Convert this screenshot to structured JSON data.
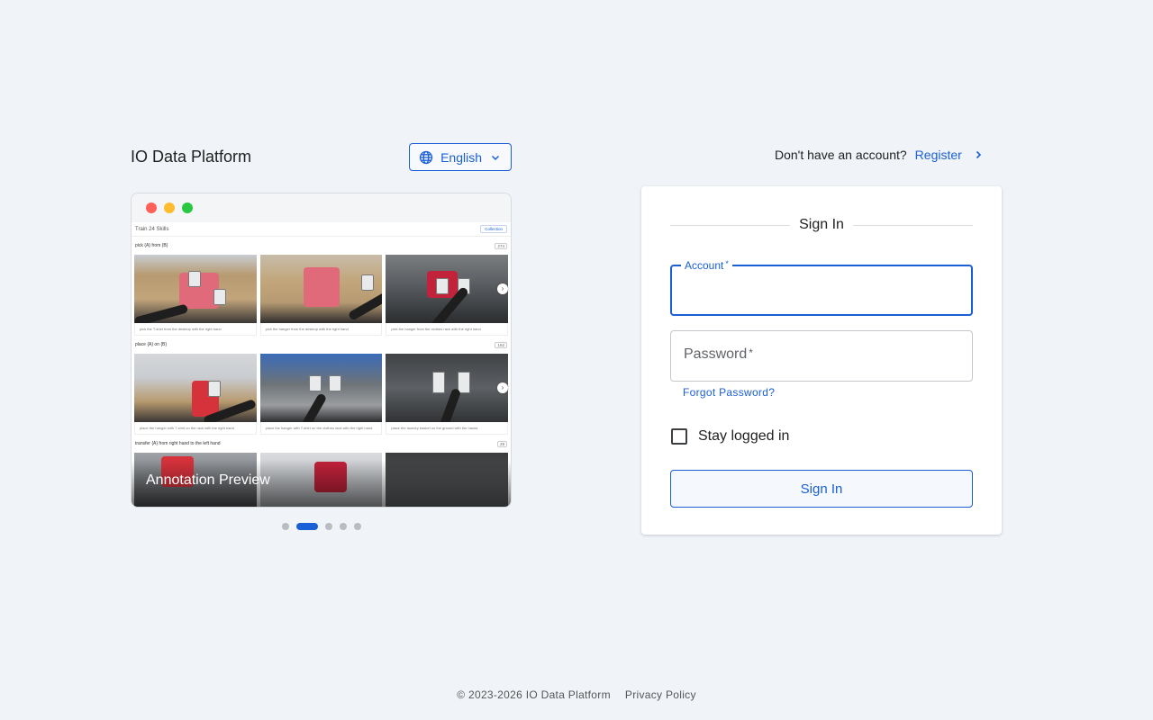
{
  "brand": {
    "name": "IO Data Platform"
  },
  "language": {
    "label": "English",
    "icon": "globe-icon",
    "chevron": "chevron-down-icon"
  },
  "preview": {
    "header_title": "Train 24 Skills",
    "collection_chip": "Collection",
    "sections": [
      {
        "title": "pick {A} from {B}",
        "count": "274",
        "captions": [
          "pick the T-shirt from the desktop with the right hand",
          "pick the hanger from the desktop with the right hand",
          "pick the hanger from the clothes rack with the right hand"
        ]
      },
      {
        "title": "place {A} on {B}",
        "count": "162",
        "captions": [
          "place the hanger with T-shirt on the rack with the right hand",
          "place the hanger with T-shirt on the clothes rack with the right hand",
          "place the laundry basket on the ground with the hands"
        ]
      },
      {
        "title": "transfer {A} from right hand to the left hand",
        "count": "29"
      }
    ],
    "slide_label": "Annotation Preview",
    "pager": {
      "total": 5,
      "active_index": 1
    }
  },
  "register": {
    "question": "Don't have an account?",
    "link": "Register"
  },
  "signin": {
    "title": "Sign In",
    "account_label": "Account",
    "account_value": "",
    "password_label": "Password",
    "password_value": "",
    "required_mark": "*",
    "forgot": "Forgot Password?",
    "stay_logged_in": "Stay logged in",
    "submit": "Sign In"
  },
  "footer": {
    "copyright": "© 2023-2026 IO Data Platform",
    "privacy": "Privacy Policy"
  },
  "colors": {
    "accent": "#1a5fd6",
    "background": "#f0f4f9"
  }
}
